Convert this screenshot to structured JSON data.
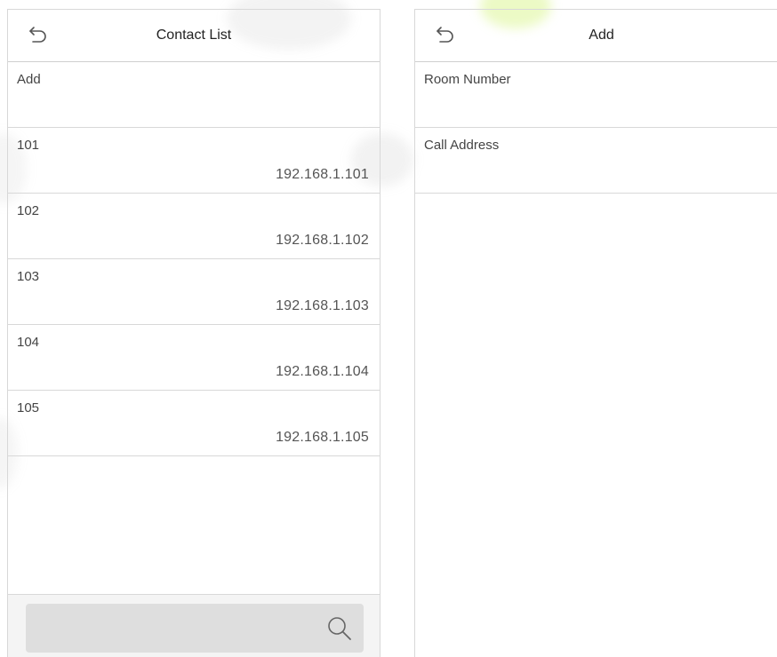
{
  "left_panel": {
    "header": {
      "title": "Contact List",
      "back_icon": "back-arrow-icon"
    },
    "add_label": "Add",
    "contacts": [
      {
        "room": "101",
        "address": "192.168.1.101"
      },
      {
        "room": "102",
        "address": "192.168.1.102"
      },
      {
        "room": "103",
        "address": "192.168.1.103"
      },
      {
        "room": "104",
        "address": "192.168.1.104"
      },
      {
        "room": "105",
        "address": "192.168.1.105"
      }
    ],
    "footer": {
      "search_icon": "search-icon"
    }
  },
  "right_panel": {
    "header": {
      "title": "Add",
      "back_icon": "back-arrow-icon"
    },
    "fields": [
      {
        "label": "Room Number",
        "value": ""
      },
      {
        "label": "Call Address",
        "value": ""
      }
    ]
  }
}
